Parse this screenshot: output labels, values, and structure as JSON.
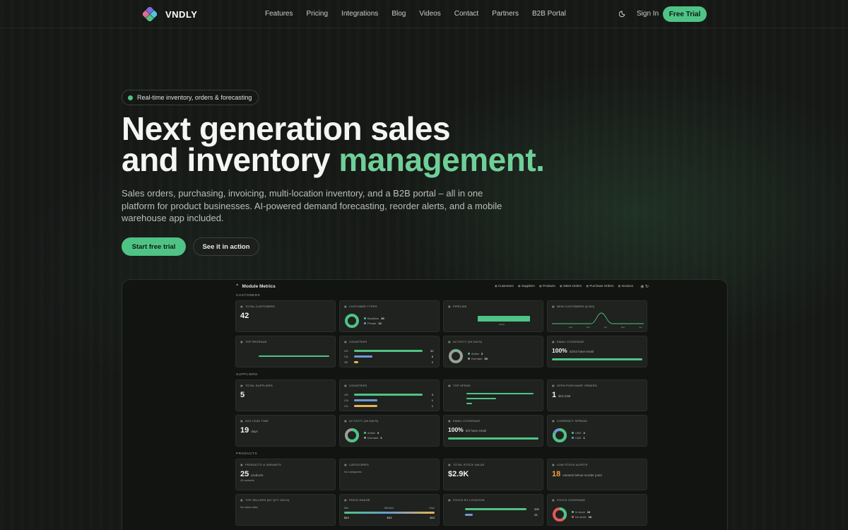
{
  "nav": {
    "brand": "VNDLY",
    "links": [
      "Features",
      "Pricing",
      "Integrations",
      "Blog",
      "Videos",
      "Contact",
      "Partners",
      "B2B Portal"
    ],
    "theme_icon": "moon-icon",
    "signin": "Sign In",
    "cta": "Free Trial"
  },
  "hero": {
    "badge": "Real-time inventory, orders & forecasting",
    "headline_1": "Next generation sales",
    "headline_2a": "and inventory ",
    "headline_2b": "management.",
    "subtext": "Sales orders, purchasing, invoicing, multi-location inventory, and a B2B portal – all in one platform for product businesses. AI-powered demand forecasting, reorder alerts, and a mobile warehouse app included.",
    "primary_cta": "Start free trial",
    "secondary_cta": "See it in action"
  },
  "colors": {
    "accent": "#4fc385",
    "accent_text": "#6fcf97",
    "orange": "#f0a238",
    "blue": "#6b9bd1",
    "yellow": "#e6b450",
    "red": "#e05a5a",
    "gray": "#9aa09a"
  },
  "dashboard": {
    "title": "Module Metrics",
    "tabs": [
      "Customers",
      "Suppliers",
      "Products",
      "Sales Orders",
      "Purchase Orders",
      "Invoices"
    ],
    "customers": {
      "label": "CUSTOMERS",
      "total_title": "TOTAL CUSTOMERS",
      "total": "42",
      "types_title": "CUSTOMER TYPES",
      "types": [
        {
          "name": "Business",
          "value": "30"
        },
        {
          "name": "Private",
          "value": "12"
        }
      ],
      "pipeline_title": "PIPELINE",
      "pipeline_label": "Active",
      "new_title": "NEW CUSTOMERS (6 MO)",
      "new_months": [
        "Feb",
        "Mar",
        "Apr",
        "May",
        "Jun"
      ],
      "revenue_title": "TOP REVENUE",
      "countries_title": "COUNTRIES",
      "countries": [
        {
          "code": "US",
          "value": "32",
          "fill": 0.95
        },
        {
          "code": "CA",
          "value": "8",
          "fill": 0.25
        },
        {
          "code": "SE",
          "value": "2",
          "fill": 0.06
        }
      ],
      "activity_title": "ACTIVITY (90 DAYS)",
      "activity": [
        {
          "name": "Active",
          "value": "3"
        },
        {
          "name": "Dormant",
          "value": "39"
        }
      ],
      "email_title": "EMAIL COVERAGE",
      "email_pct": "100%",
      "email_sub": "42/42 have email"
    },
    "suppliers": {
      "label": "SUPPLIERS",
      "total_title": "TOTAL SUPPLIERS",
      "total": "5",
      "countries_title": "COUNTRIES",
      "countries": [
        {
          "code": "US",
          "value": "3",
          "fill": 0.95
        },
        {
          "code": "CN",
          "value": "1",
          "fill": 0.32
        },
        {
          "code": "CA",
          "value": "1",
          "fill": 0.32
        }
      ],
      "spend_title": "TOP SPEND",
      "open_po_title": "OPEN PURCHASE ORDERS",
      "open_po": "1",
      "open_po_sub": "$15 total",
      "lead_title": "AVG LEAD TIME",
      "lead": "19",
      "lead_unit": "days",
      "activity_title": "ACTIVITY (90 DAYS)",
      "activity": [
        {
          "name": "Active",
          "value": "3"
        },
        {
          "name": "Dormant",
          "value": "2"
        }
      ],
      "email_title": "EMAIL COVERAGE",
      "email_pct": "100%",
      "email_sub": "5/5 have email",
      "currency_title": "CURRENCY SPREAD",
      "currency": [
        {
          "name": "USD",
          "value": "4"
        },
        {
          "name": "CAD",
          "value": "1"
        }
      ]
    },
    "products": {
      "label": "PRODUCTS",
      "variants_title": "PRODUCTS & VARIANTS",
      "products": "25",
      "products_unit": "products",
      "variants_sub": "26 variants",
      "categories_title": "CATEGORIES",
      "categories_empty": "No categories",
      "stock_value_title": "TOTAL STOCK VALUE",
      "stock_value": "$2.9K",
      "low_stock_title": "LOW STOCK ALERTS",
      "low_stock": "18",
      "low_stock_sub": "variants below reorder point",
      "sellers_title": "TOP SELLERS (BY QTY SOLD)",
      "sellers_empty": "No sales data",
      "price_title": "PRICE RANGE",
      "price_labels": [
        "Min",
        "Median",
        "Max"
      ],
      "price_values": [
        "$43",
        "$43",
        "$43"
      ],
      "location_title": "STOCK BY LOCATION",
      "locations": [
        {
          "value": "209",
          "fill": 0.95
        },
        {
          "value": "25",
          "fill": 0.12
        }
      ],
      "coverage_title": "STOCK COVERAGE",
      "coverage": [
        {
          "name": "In stock",
          "value": "10"
        },
        {
          "name": "No stock",
          "value": "16"
        }
      ]
    }
  }
}
